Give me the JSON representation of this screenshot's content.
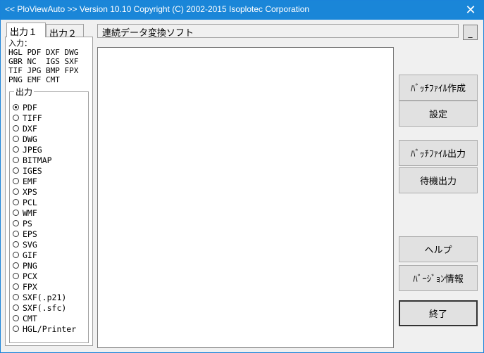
{
  "window": {
    "title": "<< PloViewAuto >>  Version 10.10 Copyright (C) 2002-2015 Isoplotec Corporation",
    "close_label": "✕"
  },
  "tabs": [
    {
      "label": "出力１"
    },
    {
      "label": "出力２"
    }
  ],
  "input_section": {
    "heading": "入力：",
    "formats": "HGL PDF DXF DWG\nGBR NC  IGS SXF\nTIF JPG BMP FPX\nPNG EMF CMT"
  },
  "output_group": {
    "label": "出力",
    "selected": "PDF",
    "options": [
      "PDF",
      "TIFF",
      "DXF",
      "DWG",
      "JPEG",
      "BITMAP",
      "IGES",
      "EMF",
      "XPS",
      "PCL",
      "WMF",
      "PS",
      "EPS",
      "SVG",
      "GIF",
      "PNG",
      "PCX",
      "FPX",
      "SXF(.p21)",
      "SXF(.sfc)",
      "CMT",
      "HGL/Printer"
    ]
  },
  "header": {
    "text": "連続データ変換ソフト",
    "minimize_label": "_"
  },
  "buttons": {
    "batch_create": "ﾊﾞｯﾁﾌｧｲﾙ作成",
    "settings": "設定",
    "batch_output": "ﾊﾞｯﾁﾌｧｲﾙ出力",
    "wait_output": "待機出力",
    "help": "ヘルプ",
    "version_info": "ﾊﾞｰｼﾞｮﾝ情報",
    "exit": "終了"
  },
  "colors": {
    "titlebar": "#1a86d8",
    "window_bg": "#f0f0f0",
    "button_bg": "#e1e1e1"
  }
}
